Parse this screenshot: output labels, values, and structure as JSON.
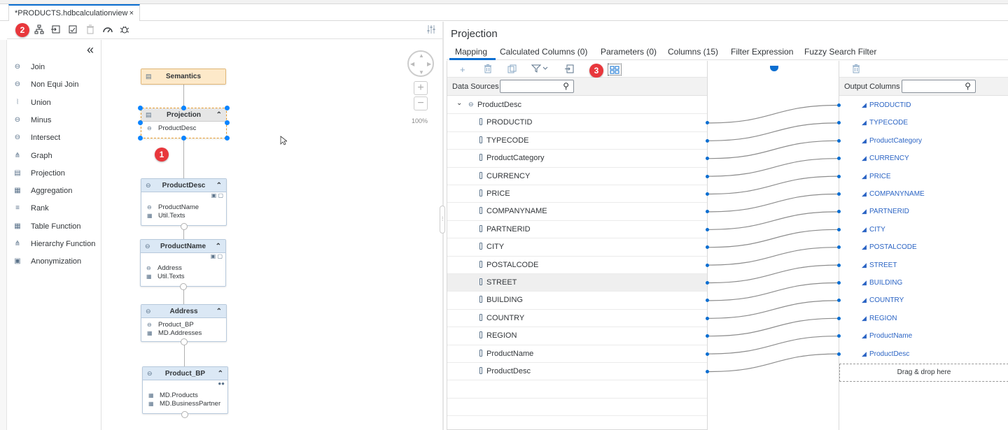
{
  "editor_tab": {
    "title": "*PRODUCTS.hdbcalculationview",
    "close": "×"
  },
  "badges": {
    "one": "1",
    "two": "2",
    "three": "3"
  },
  "palette": {
    "items": [
      {
        "label": "Join",
        "icon": "join-icon",
        "glyph": "⊖"
      },
      {
        "label": "Non Equi Join",
        "icon": "non-equi-join-icon",
        "glyph": "⊖"
      },
      {
        "label": "Union",
        "icon": "union-icon",
        "glyph": "⦚"
      },
      {
        "label": "Minus",
        "icon": "minus-icon",
        "glyph": "⊖"
      },
      {
        "label": "Intersect",
        "icon": "intersect-icon",
        "glyph": "⊖"
      },
      {
        "label": "Graph",
        "icon": "graph-icon",
        "glyph": "⋔"
      },
      {
        "label": "Projection",
        "icon": "projection-icon",
        "glyph": "▤"
      },
      {
        "label": "Aggregation",
        "icon": "aggregation-icon",
        "glyph": "▦"
      },
      {
        "label": "Rank",
        "icon": "rank-icon",
        "glyph": "≡"
      },
      {
        "label": "Table Function",
        "icon": "table-function-icon",
        "glyph": "▦"
      },
      {
        "label": "Hierarchy Function",
        "icon": "hierarchy-function-icon",
        "glyph": "⋔"
      },
      {
        "label": "Anonymization",
        "icon": "anonymization-icon",
        "glyph": "▣"
      }
    ]
  },
  "canvas": {
    "zoom": "100%",
    "nodes": {
      "semantics": {
        "title": "Semantics"
      },
      "projection": {
        "title": "Projection",
        "rows": [
          "ProductDesc"
        ]
      },
      "productdesc": {
        "title": "ProductDesc",
        "rows": [
          "ProductName",
          "Util.Texts"
        ]
      },
      "productname": {
        "title": "ProductName",
        "rows": [
          "Address",
          "Util.Texts"
        ]
      },
      "address": {
        "title": "Address",
        "rows": [
          "Product_BP",
          "MD.Addresses"
        ]
      },
      "product_bp": {
        "title": "Product_BP",
        "rows": [
          "MD.Products",
          "MD.BusinessPartner"
        ]
      }
    }
  },
  "panel": {
    "title": "Projection",
    "tabs": [
      "Mapping",
      "Calculated Columns (0)",
      "Parameters (0)",
      "Columns (15)",
      "Filter Expression",
      "Fuzzy Search Filter"
    ],
    "data_sources_label": "Data Sources",
    "output_columns_label": "Output Columns",
    "source_node": "ProductDesc",
    "source_columns": [
      "PRODUCTID",
      "TYPECODE",
      "ProductCategory",
      "CURRENCY",
      "PRICE",
      "COMPANYNAME",
      "PARTNERID",
      "CITY",
      "POSTALCODE",
      "STREET",
      "BUILDING",
      "COUNTRY",
      "REGION",
      "ProductName",
      "ProductDesc"
    ],
    "output_columns": [
      "PRODUCTID",
      "TYPECODE",
      "ProductCategory",
      "CURRENCY",
      "PRICE",
      "COMPANYNAME",
      "PARTNERID",
      "CITY",
      "POSTALCODE",
      "STREET",
      "BUILDING",
      "COUNTRY",
      "REGION",
      "ProductName",
      "ProductDesc"
    ],
    "drop_hint": "Drag & drop here",
    "highlighted_row": "STREET"
  },
  "colors": {
    "accent": "#0a6ed1",
    "badge": "#e8373c",
    "selection": "#0a84ff"
  }
}
